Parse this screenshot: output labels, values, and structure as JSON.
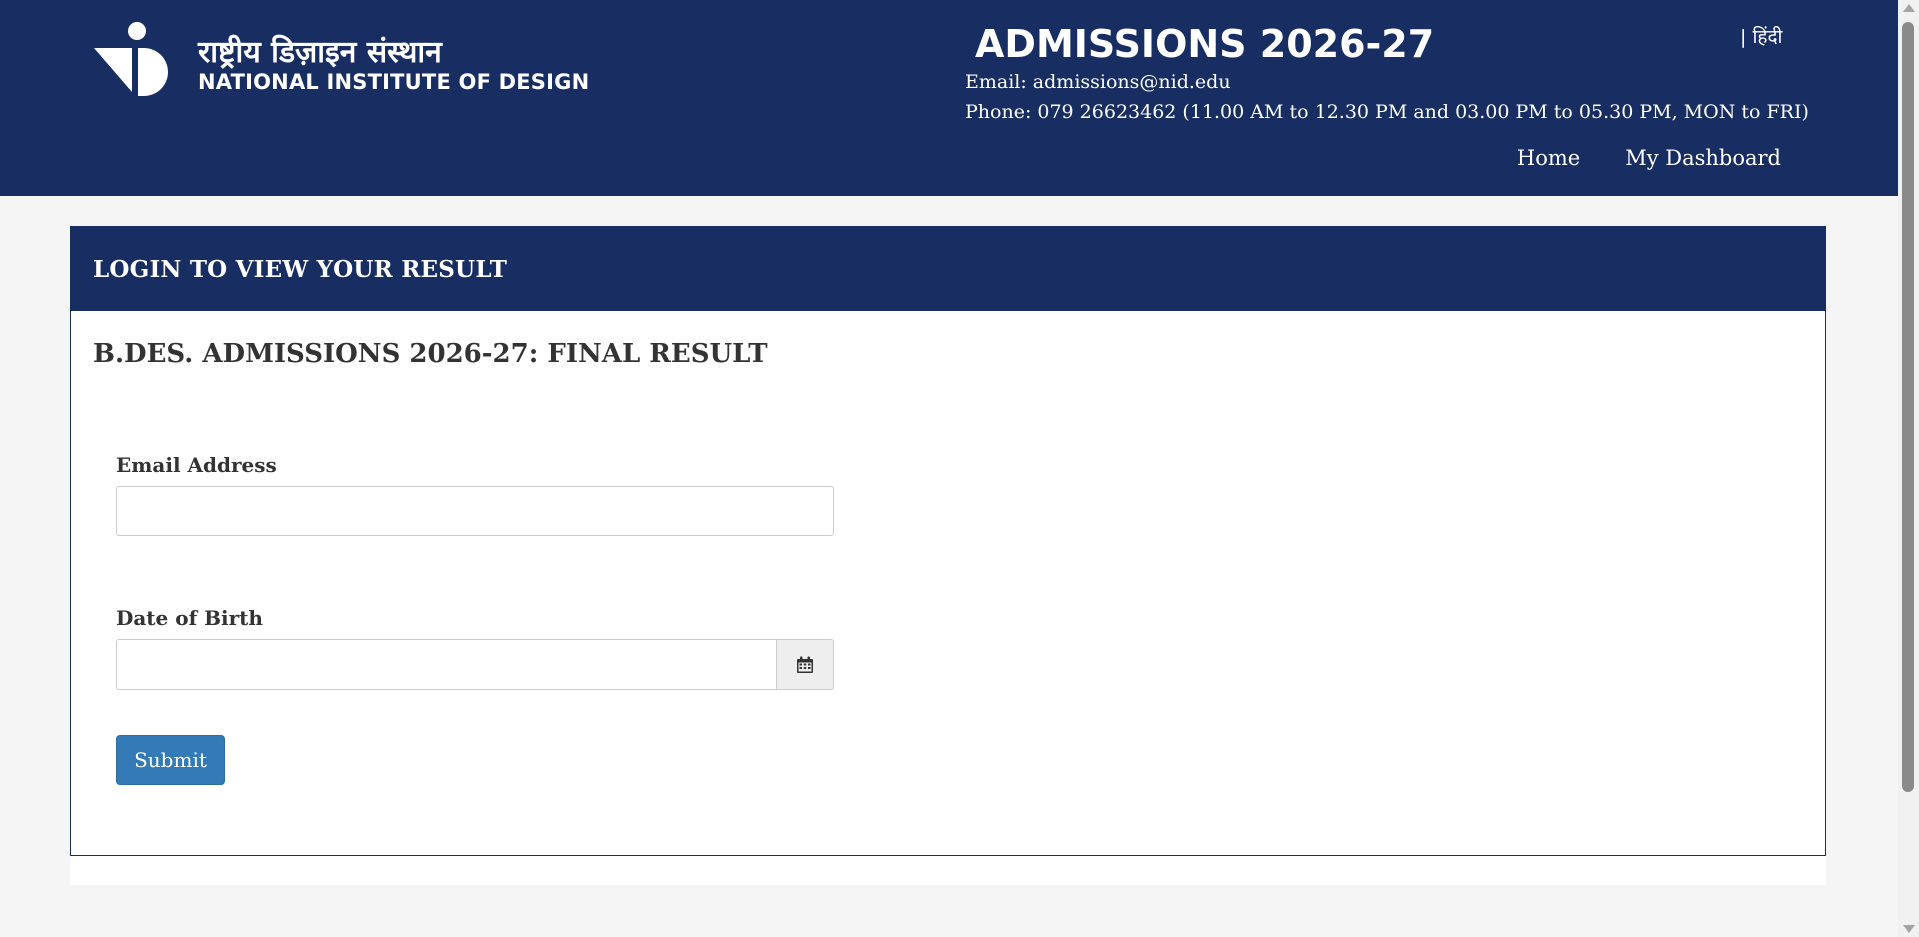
{
  "header": {
    "logo_hindi": "राष्ट्रीय डिज़ाइन संस्थान",
    "logo_english": "NATIONAL INSTITUTE OF DESIGN",
    "admissions_title": "ADMISSIONS 2026-27",
    "email_line": "Email: admissions@nid.edu",
    "phone_line": "Phone: 079 26623462 (11.00 AM to 12.30 PM and 03.00 PM to 05.30 PM, MON to FRI)",
    "language_switch": "| हिंदी",
    "nav": {
      "home": "Home",
      "dashboard": "My Dashboard"
    }
  },
  "panel": {
    "heading": "LOGIN TO VIEW YOUR RESULT",
    "result_title": "B.DES. ADMISSIONS 2026-27: FINAL RESULT"
  },
  "form": {
    "email_label": "Email Address",
    "email_value": "",
    "dob_label": "Date of Birth",
    "dob_value": "",
    "calendar_icon": "calendar-icon",
    "submit_label": "Submit"
  },
  "colors": {
    "brand_navy": "#182d61",
    "button_blue": "#337ab7",
    "page_bg": "#f5f5f5"
  }
}
